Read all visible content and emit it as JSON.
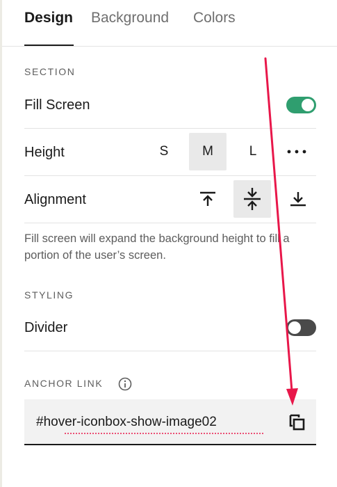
{
  "tabs": [
    {
      "label": "Design",
      "active": true
    },
    {
      "label": "Background",
      "active": false
    },
    {
      "label": "Colors",
      "active": false
    }
  ],
  "section": {
    "heading": "SECTION",
    "fill_screen": {
      "label": "Fill Screen",
      "enabled": true
    },
    "height": {
      "label": "Height",
      "options": [
        "S",
        "M",
        "L"
      ],
      "selected": "M",
      "more_icon": "more-horizontal-icon"
    },
    "alignment": {
      "label": "Alignment",
      "options": [
        "align-top-icon",
        "align-center-icon",
        "align-bottom-icon"
      ],
      "selected": "align-center-icon"
    },
    "description": "Fill screen will expand the background height to fill a portion of the user’s screen."
  },
  "styling": {
    "heading": "STYLING",
    "divider": {
      "label": "Divider",
      "enabled": false
    }
  },
  "anchor": {
    "heading": "ANCHOR LINK",
    "info_icon": "info-icon",
    "value": "#hover-iconbox-show-image02",
    "copy_icon": "copy-icon"
  },
  "colors": {
    "accent_green": "#2f9e6f",
    "annotation_arrow": "#e8174a",
    "toggle_off": "#4a4a4a"
  }
}
